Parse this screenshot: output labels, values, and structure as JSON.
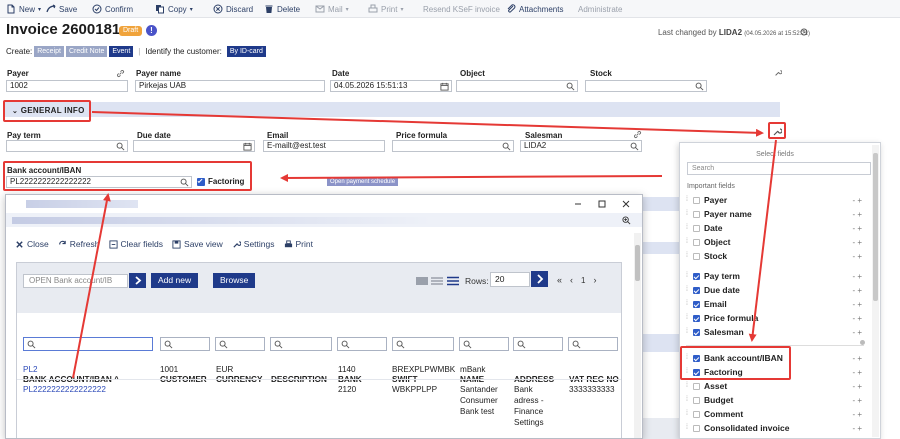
{
  "toolbar": {
    "items": [
      {
        "label": "New",
        "icon": "new-doc-icon",
        "dropdown": true,
        "enabled": true
      },
      {
        "label": "Save",
        "icon": "save-icon",
        "enabled": true
      },
      {
        "label": "Confirm",
        "icon": "check-circle-icon",
        "enabled": true
      },
      {
        "label": "Copy",
        "icon": "copy-icon",
        "dropdown": true,
        "enabled": true
      },
      {
        "label": "Discard",
        "icon": "discard-icon",
        "enabled": true
      },
      {
        "label": "Delete",
        "icon": "trash-icon",
        "enabled": true
      },
      {
        "label": "Mail",
        "icon": "mail-icon",
        "dropdown": true,
        "enabled": false
      },
      {
        "label": "Print",
        "icon": "print-icon",
        "dropdown": true,
        "enabled": false
      },
      {
        "label": "Resend KSeF invoice",
        "enabled": false
      },
      {
        "label": "Attachments",
        "icon": "paperclip-icon",
        "enabled": true
      },
      {
        "label": "Administrate",
        "enabled": false
      }
    ]
  },
  "header": {
    "title": "Invoice 2600181",
    "badge": "Draft",
    "last_changed_prefix": "Last changed by",
    "last_changed_user": "LIDA2",
    "last_changed_time": "(04.05.2026 at 15:52:21)"
  },
  "create_row": {
    "label": "Create:",
    "buttons": [
      "Receipt",
      "Credit Note",
      "Event"
    ],
    "identify_label": "Identify the customer:",
    "identify_button": "By ID-card"
  },
  "top_fields": {
    "payer": {
      "label": "Payer",
      "value": "1002"
    },
    "payer_name": {
      "label": "Payer name",
      "value": "Pirkejas UAB"
    },
    "date": {
      "label": "Date",
      "value": "04.05.2026 15:51:13"
    },
    "object": {
      "label": "Object",
      "value": ""
    },
    "stock": {
      "label": "Stock",
      "value": ""
    }
  },
  "general_info": {
    "label": "GENERAL INFO",
    "pay_term": {
      "label": "Pay term",
      "value": ""
    },
    "due_date": {
      "label": "Due date",
      "value": ""
    },
    "email": {
      "label": "Email",
      "value": "E-mailt@est.test"
    },
    "price_formula": {
      "label": "Price formula",
      "value": ""
    },
    "salesman": {
      "label": "Salesman",
      "value": "LIDA2"
    },
    "bank_account": {
      "label": "Bank account/IBAN",
      "value": "PL2222222222222222"
    },
    "factoring": {
      "label": "Factoring",
      "checked": true
    },
    "open_payment_schedule": "Open payment schedule"
  },
  "popup": {
    "tools": [
      "Close",
      "Refresh",
      "Clear fields",
      "Save view",
      "Settings",
      "Print"
    ],
    "open_placeholder": "OPEN Bank account/IB",
    "add_new": "Add new",
    "browse": "Browse",
    "rows_label": "Rows:",
    "rows_value": "20",
    "page": "1",
    "columns": [
      "BANK ACCOUNT/IBAN ^",
      "CUSTOMER",
      "CURRENCY",
      "DESCRIPTION",
      "BANK",
      "SWIFT",
      "NAME",
      "ADDRESS",
      "VAT REG NO"
    ],
    "rows": [
      {
        "iban": "PL2",
        "customer": "1001",
        "currency": "EUR",
        "description": "",
        "bank": "1140",
        "swift": "BREXPLPWMBK",
        "name": "mBank",
        "address": "",
        "vat": ""
      },
      {
        "iban": "PL2222222222222222",
        "customer": "",
        "currency": "",
        "description": "",
        "bank": "2120",
        "swift": "WBKPPLPP",
        "name": [
          "Santander",
          "Consumer",
          "Bank test"
        ],
        "address": [
          "Bank",
          "adress -",
          "Finance",
          "Settings"
        ],
        "vat": "3333333333"
      }
    ]
  },
  "select_fields": {
    "title": "Select fields",
    "search_placeholder": "Search",
    "important_label": "Important fields",
    "items": [
      {
        "label": "Payer",
        "checked": false
      },
      {
        "label": "Payer name",
        "checked": false
      },
      {
        "label": "Date",
        "checked": false
      },
      {
        "label": "Object",
        "checked": false
      },
      {
        "label": "Stock",
        "checked": false
      },
      {
        "label": "Pay term",
        "checked": true
      },
      {
        "label": "Due date",
        "checked": true
      },
      {
        "label": "Email",
        "checked": true
      },
      {
        "label": "Price formula",
        "checked": true
      },
      {
        "label": "Salesman",
        "checked": true
      },
      {
        "label": "Bank account/IBAN",
        "checked": true
      },
      {
        "label": "Factoring",
        "checked": true
      },
      {
        "label": "Asset",
        "checked": false
      },
      {
        "label": "Budget",
        "checked": false
      },
      {
        "label": "Comment",
        "checked": false
      },
      {
        "label": "Consolidated invoice",
        "checked": false
      }
    ],
    "item_controls": "- +"
  },
  "colors": {
    "accent": "#1f3a8a",
    "section_band": "#dde3f2",
    "annotation_red": "#e53935",
    "draft_badge": "#f0a33b",
    "link": "#2c4ab8"
  }
}
